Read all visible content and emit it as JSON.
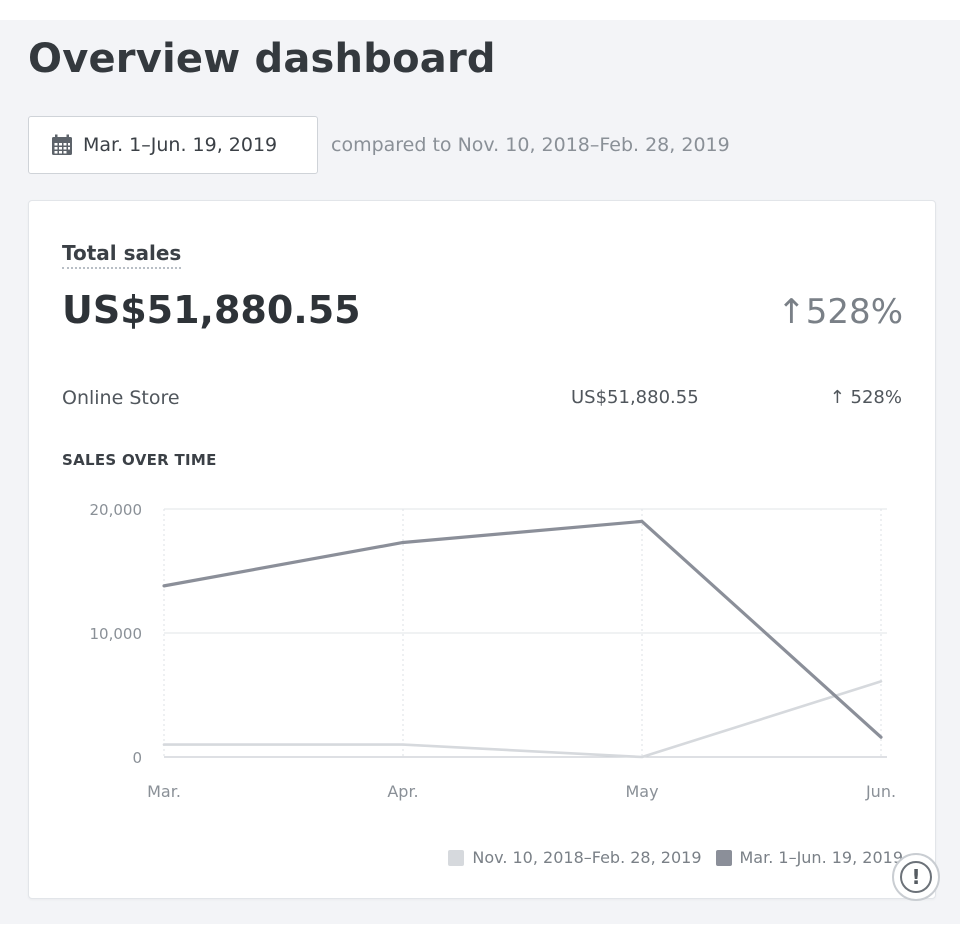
{
  "page": {
    "title": "Overview dashboard"
  },
  "date_range": {
    "label": "Mar. 1–Jun. 19, 2019",
    "icon": "calendar-icon",
    "compare_text": "compared to Nov. 10, 2018–Feb. 28, 2019"
  },
  "total_sales": {
    "title": "Total sales",
    "value": "US$51,880.55",
    "change": "528%",
    "change_icon": "arrow-up-icon",
    "breakdown": [
      {
        "label": "Online Store",
        "value": "US$51,880.55",
        "change": "528%"
      }
    ]
  },
  "chart_heading": "SALES OVER TIME",
  "chart_data": {
    "type": "line",
    "title": "SALES OVER TIME",
    "categories": [
      "Mar.",
      "Apr.",
      "May",
      "Jun."
    ],
    "series": [
      {
        "name": "Nov. 10, 2018–Feb. 28, 2019",
        "values": [
          1000,
          1000,
          0,
          6100
        ],
        "color": "#d6d9dd"
      },
      {
        "name": "Mar. 1–Jun. 19, 2019",
        "values": [
          13800,
          17300,
          19000,
          1600
        ],
        "color": "#8b8f99"
      }
    ],
    "ylim": [
      0,
      20000
    ],
    "yticks": [
      "0",
      "10,000",
      "20,000"
    ],
    "ytick_values": [
      0,
      10000,
      20000
    ],
    "grid": true,
    "legend": "bottom-right"
  },
  "help": {
    "icon": "alert-icon",
    "glyph": "!"
  }
}
